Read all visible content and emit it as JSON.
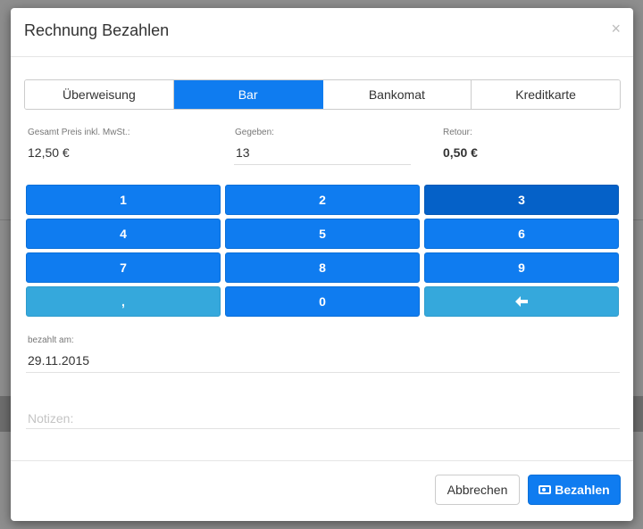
{
  "dialog": {
    "title": "Rechnung Bezahlen",
    "close_symbol": "×"
  },
  "tabs": [
    {
      "label": "Überweisung",
      "active": false
    },
    {
      "label": "Bar",
      "active": true
    },
    {
      "label": "Bankomat",
      "active": false
    },
    {
      "label": "Kreditkarte",
      "active": false
    }
  ],
  "summary": {
    "total_label": "Gesamt Preis inkl. MwSt.:",
    "total_value": "12,50 €",
    "given_label": "Gegeben:",
    "given_value": "13",
    "return_label": "Retour:",
    "return_value": "0,50 €"
  },
  "keypad": {
    "keys": [
      "1",
      "2",
      "3",
      "4",
      "5",
      "6",
      "7",
      "8",
      "9",
      ",",
      "0",
      "backspace"
    ],
    "backspace_icon": "arrow-left-icon"
  },
  "paid_on": {
    "label": "bezahlt am:",
    "value": "29.11.2015"
  },
  "notes": {
    "placeholder": "Notizen:",
    "value": ""
  },
  "footer": {
    "cancel_label": "Abbrechen",
    "pay_label": "Bezahlen",
    "pay_icon": "money-icon"
  },
  "colors": {
    "accent": "#0f7cf0",
    "key_highlight": "#0561c8",
    "key_light": "#35a8dc"
  }
}
